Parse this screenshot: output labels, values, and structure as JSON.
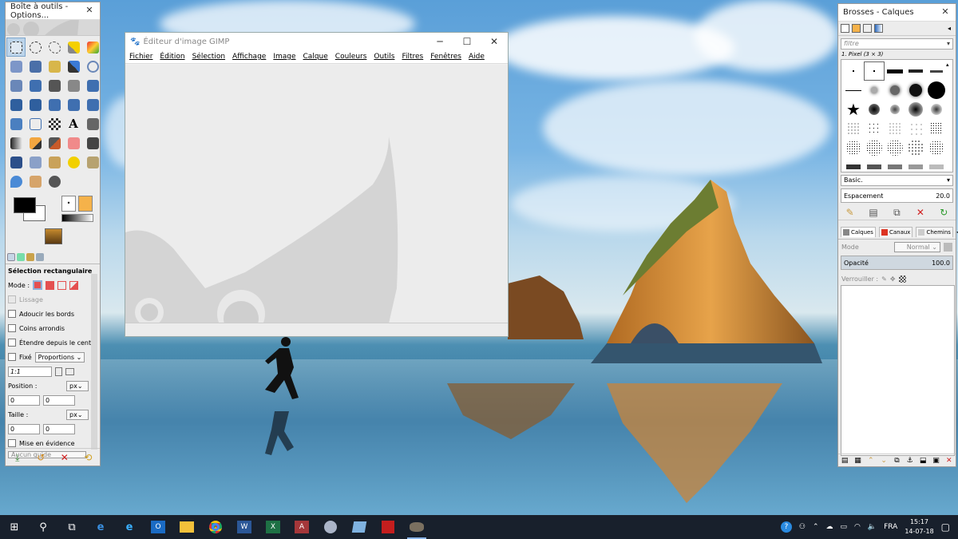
{
  "toolbox": {
    "title": "Boîte à outils - Options...",
    "active_tool": "Sélection rectangulaire",
    "options": {
      "mode_label": "Mode :",
      "lissage": "Lissage",
      "adoucir": "Adoucir les bords",
      "coins": "Coins arrondis",
      "etendre": "Étendre depuis le centre",
      "fixe": "Fixé",
      "proportions": "Proportions",
      "ratio": "1:1",
      "position_label": "Position :",
      "size_label": "Taille :",
      "unit": "px",
      "pos_x": "0",
      "pos_y": "0",
      "size_w": "0",
      "size_h": "0",
      "mise_en_evidence": "Mise en évidence",
      "guide": "Aucun guide"
    }
  },
  "gimp": {
    "title": "Éditeur d'image GIMP",
    "menu": [
      "Fichier",
      "Édition",
      "Sélection",
      "Affichage",
      "Image",
      "Calque",
      "Couleurs",
      "Outils",
      "Filtres",
      "Fenêtres",
      "Aide"
    ]
  },
  "dock": {
    "title": "Brosses - Calques",
    "filter_placeholder": "filtre",
    "brush_name": "1. Pixel (3 × 3)",
    "brush_set": "Basic.",
    "spacing_label": "Espacement",
    "spacing_value": "20.0",
    "tabs": {
      "calques": "Calques",
      "canaux": "Canaux",
      "chemins": "Chemins"
    },
    "mode_label": "Mode",
    "mode_value": "Normal",
    "opacity_label": "Opacité",
    "opacity_value": "100.0",
    "lock_label": "Verrouiller :"
  },
  "taskbar": {
    "language": "FRA",
    "time": "15:17",
    "date": "14-07-18"
  },
  "colors": {
    "accent": "#8ab4e8",
    "taskbar": "#18202c"
  }
}
